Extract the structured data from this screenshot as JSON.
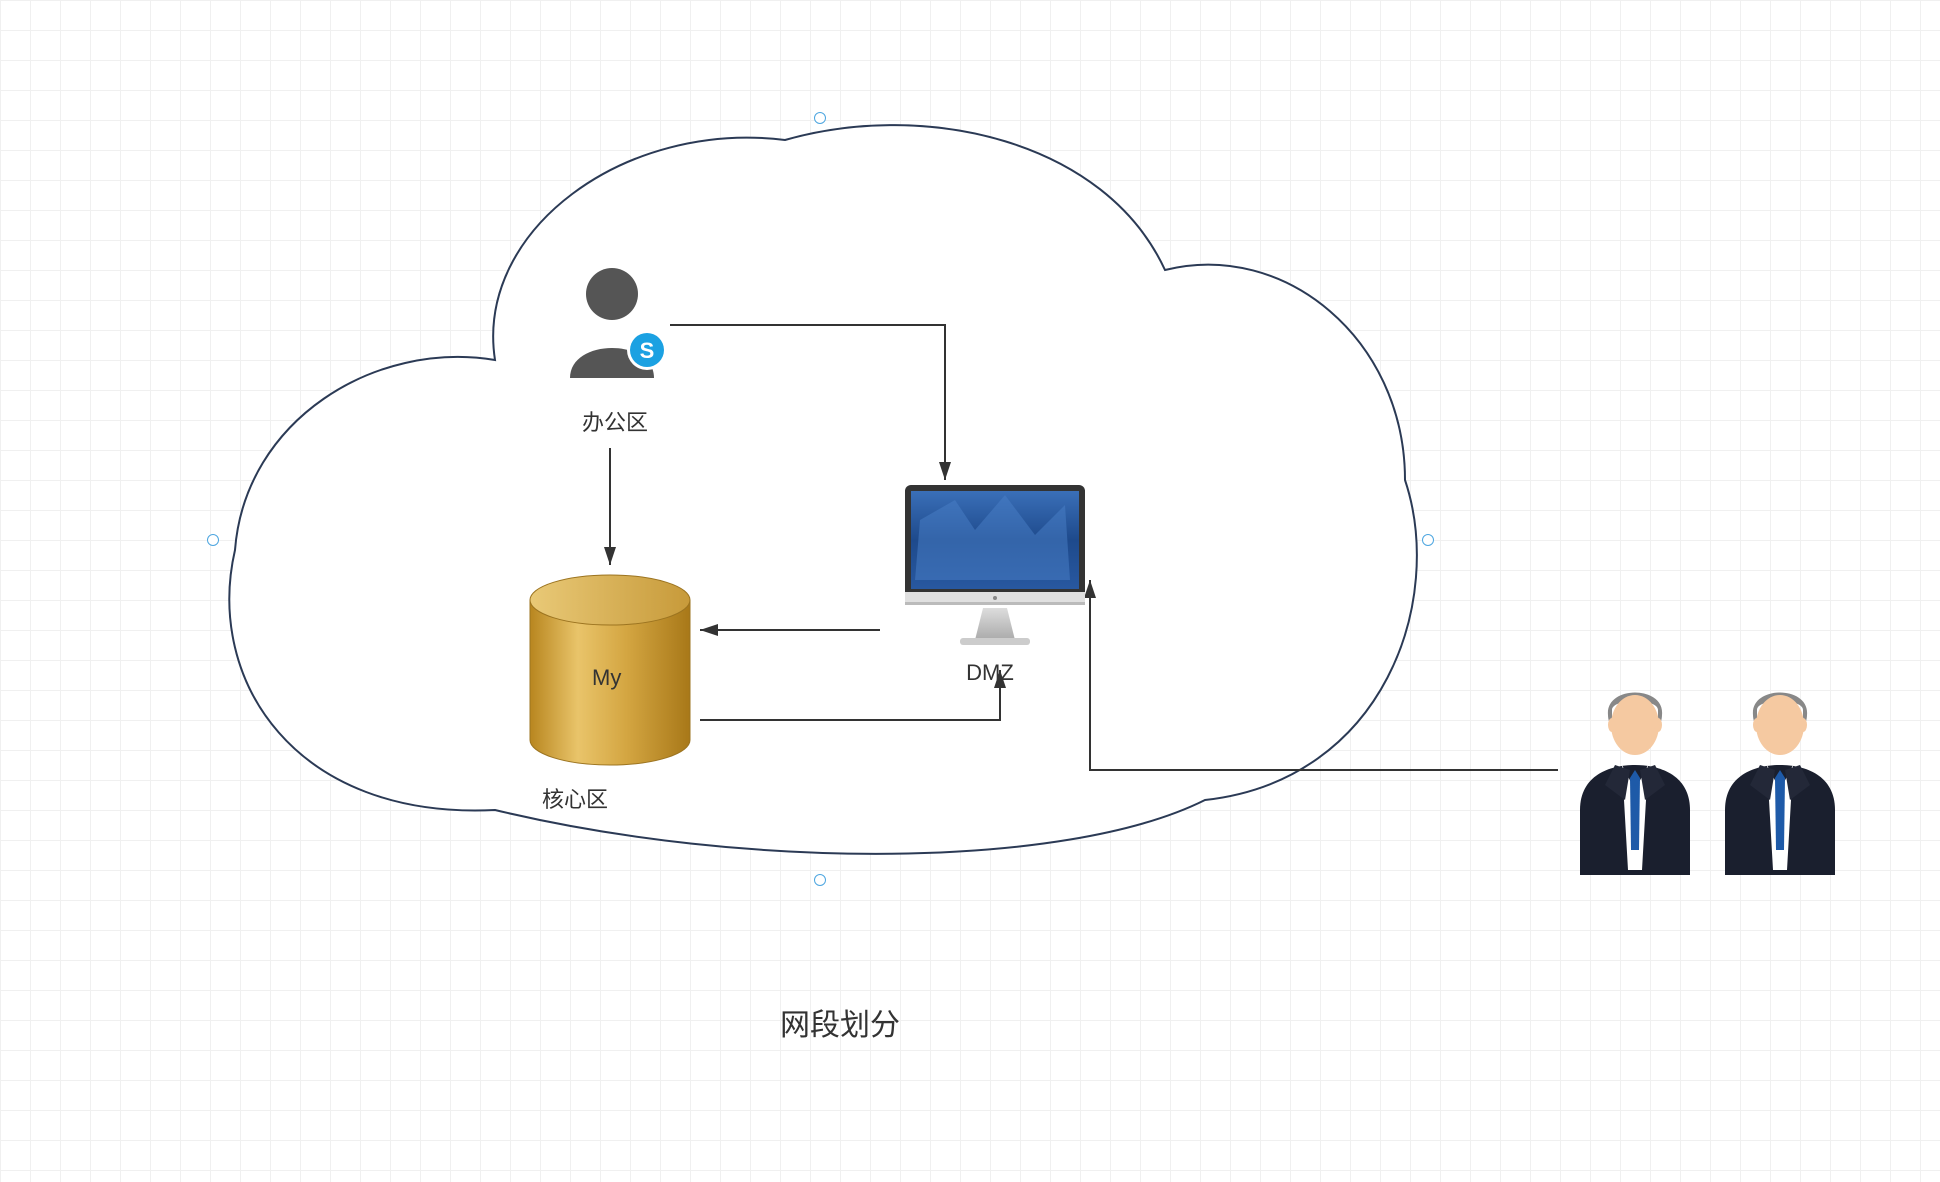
{
  "diagram": {
    "title": "网段划分",
    "nodes": {
      "office": {
        "label": "办公区"
      },
      "core": {
        "label": "核心区",
        "db_text": "My"
      },
      "dmz": {
        "label": "DMZ"
      }
    }
  }
}
